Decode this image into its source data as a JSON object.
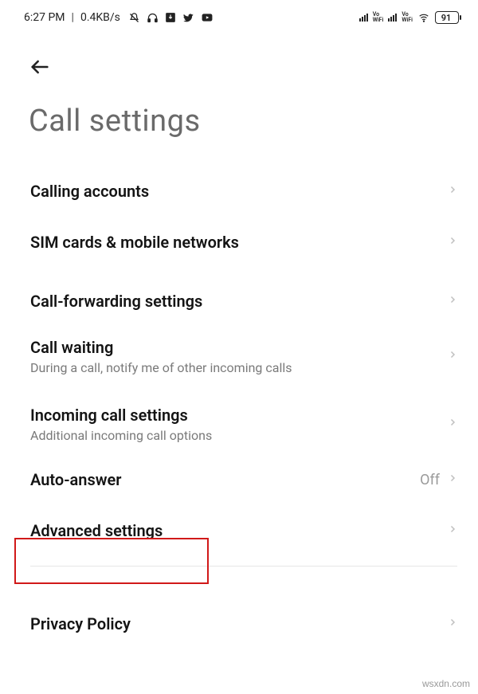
{
  "status": {
    "time": "6:27 PM",
    "speed": "0.4KB/s",
    "battery": "91"
  },
  "page": {
    "title": "Call settings"
  },
  "items": {
    "calling_accounts": {
      "title": "Calling accounts"
    },
    "sim_networks": {
      "title": "SIM cards & mobile networks"
    },
    "call_forwarding": {
      "title": "Call-forwarding settings"
    },
    "call_waiting": {
      "title": "Call waiting",
      "subtitle": "During a call, notify me of other incoming calls"
    },
    "incoming": {
      "title": "Incoming call settings",
      "subtitle": "Additional incoming call options"
    },
    "auto_answer": {
      "title": "Auto-answer",
      "value": "Off"
    },
    "advanced": {
      "title": "Advanced settings"
    },
    "privacy": {
      "title": "Privacy Policy"
    }
  },
  "watermark": "wsxdn.com"
}
